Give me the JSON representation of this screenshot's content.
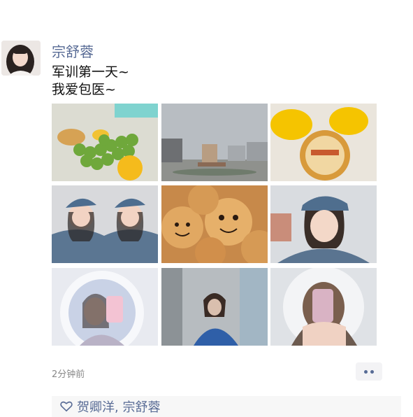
{
  "post": {
    "author": "宗舒蓉",
    "lines": [
      "军训第一天~",
      "我爱包医~"
    ],
    "time": "2分钟前"
  },
  "grid": {
    "photos": [
      "photo-fruit-grapes-oranges",
      "photo-campus-plaza-statue",
      "photo-oranges-mooncake-box",
      "photo-two-girls-camo-caps",
      "photo-mooncakes-faces",
      "photo-girl-camo-cap",
      "photo-ringlight-selfie",
      "photo-mirror-selfie",
      "photo-phone-selfie"
    ]
  },
  "likes": {
    "names": "贺卿洋, 宗舒蓉"
  },
  "colors": {
    "name": "#586b95",
    "accent": "#576b95"
  }
}
